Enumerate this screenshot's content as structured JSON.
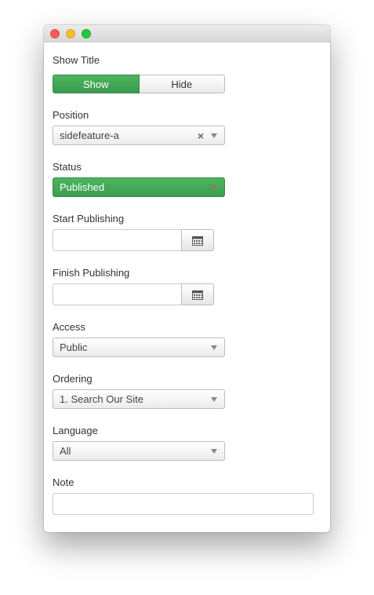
{
  "fields": {
    "show_title": {
      "label": "Show Title",
      "options": [
        "Show",
        "Hide"
      ],
      "selected": "Show"
    },
    "position": {
      "label": "Position",
      "value": "sidefeature-a",
      "clear_icon": "×"
    },
    "status": {
      "label": "Status",
      "value": "Published"
    },
    "start_publishing": {
      "label": "Start Publishing",
      "value": ""
    },
    "finish_publishing": {
      "label": "Finish Publishing",
      "value": ""
    },
    "access": {
      "label": "Access",
      "value": "Public"
    },
    "ordering": {
      "label": "Ordering",
      "value": "1. Search Our Site"
    },
    "language": {
      "label": "Language",
      "value": "All"
    },
    "note": {
      "label": "Note",
      "value": ""
    }
  },
  "colors": {
    "accent_green": "#46a857",
    "close": "#fc5f57",
    "minimize": "#fdbb2e",
    "maximize": "#28c840"
  },
  "icons": {
    "calendar": "calendar-icon",
    "dropdown": "chevron-down-icon",
    "clear": "close-icon"
  }
}
